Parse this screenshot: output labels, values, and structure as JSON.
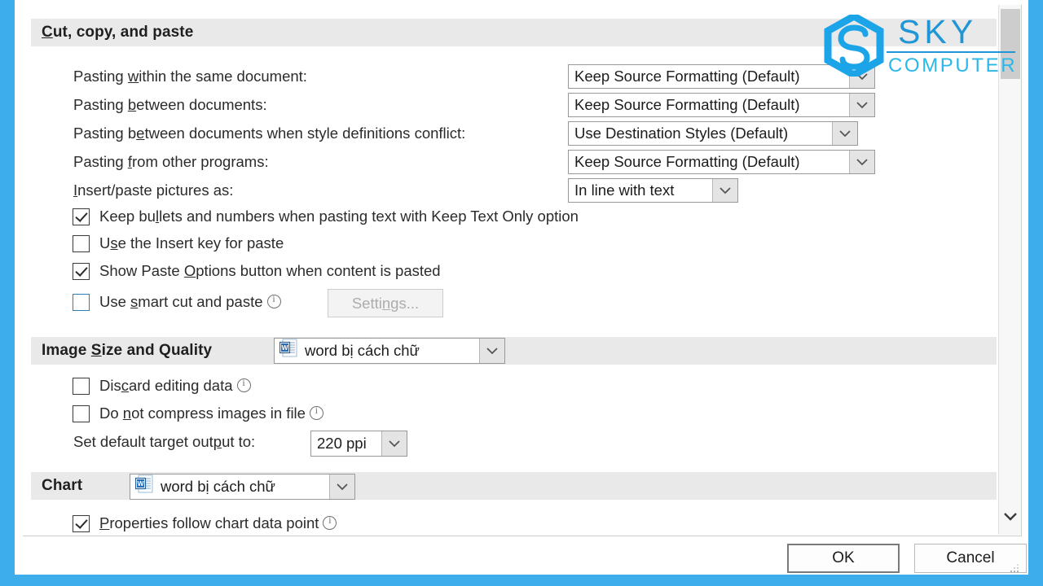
{
  "dialog": {
    "sections": [
      {
        "id": "cut-copy-paste",
        "title_pre": "C",
        "title": "Cut, copy, and paste"
      },
      {
        "id": "image-size-quality",
        "title_a": "Image ",
        "title_accel": "S",
        "title_b": "ize and Quality",
        "scope_value": "word bị cách chữ"
      },
      {
        "id": "chart",
        "title": "Chart",
        "scope_value": "word bị cách chữ"
      }
    ],
    "paste_rows": [
      {
        "label_a": "Pasting ",
        "label_accel": "w",
        "label_b": "ithin the same document:",
        "value": "Keep Source Formatting (Default)"
      },
      {
        "label_a": "Pasting ",
        "label_accel": "b",
        "label_b": "etween documents:",
        "value": "Keep Source Formatting (Default)"
      },
      {
        "label_a": "Pasting b",
        "label_accel": "e",
        "label_b": "tween documents when style definitions conflict:",
        "value": "Use Destination Styles (Default)"
      },
      {
        "label_a": "Pasting ",
        "label_accel": "f",
        "label_b": "rom other programs:",
        "value": "Keep Source Formatting (Default)"
      },
      {
        "label_a": "",
        "label_accel": "I",
        "label_b": "nsert/paste pictures as:",
        "value": "In line with text"
      }
    ],
    "paste_checkboxes": [
      {
        "checked": true,
        "focus": false,
        "label_a": "Keep bu",
        "label_accel": "l",
        "label_b": "lets and numbers when pasting text with Keep Text Only option",
        "info": false
      },
      {
        "checked": false,
        "focus": false,
        "label_a": "U",
        "label_accel": "s",
        "label_b": "e the Insert key for paste",
        "info": false
      },
      {
        "checked": true,
        "focus": false,
        "label_a": "Show Paste ",
        "label_accel": "O",
        "label_b": "ptions button when content is pasted",
        "info": false
      },
      {
        "checked": false,
        "focus": true,
        "label_a": "Use ",
        "label_accel": "s",
        "label_b": "mart cut and paste",
        "info": true
      }
    ],
    "settings_button": {
      "label_a": "Setti",
      "label_accel": "n",
      "label_b": "gs...",
      "disabled": true
    },
    "image_checkboxes": [
      {
        "checked": false,
        "label_a": "Dis",
        "label_accel": "c",
        "label_b": "ard editing data",
        "info": true
      },
      {
        "checked": false,
        "label_a": "Do ",
        "label_accel": "n",
        "label_b": "ot compress images in file",
        "info": true
      }
    ],
    "target_output": {
      "label_a": "Set default target out",
      "label_accel": "p",
      "label_b": "ut to:",
      "value": "220 ppi"
    },
    "chart_checkbox": {
      "checked": true,
      "label_a": "",
      "label_accel": "P",
      "label_b": "roperties follow chart data point",
      "info": true
    },
    "buttons": {
      "ok": "OK",
      "cancel": "Cancel"
    }
  },
  "watermark": {
    "line1": "SKY",
    "line2": "COMPUTER"
  },
  "colors": {
    "frame_blue": "#3eaeea",
    "logo_blue": "#2196d6",
    "logo_cyan": "#2bb7e8",
    "section_bar": "#e9e9e9",
    "focus_blue": "#2a7fbb"
  }
}
